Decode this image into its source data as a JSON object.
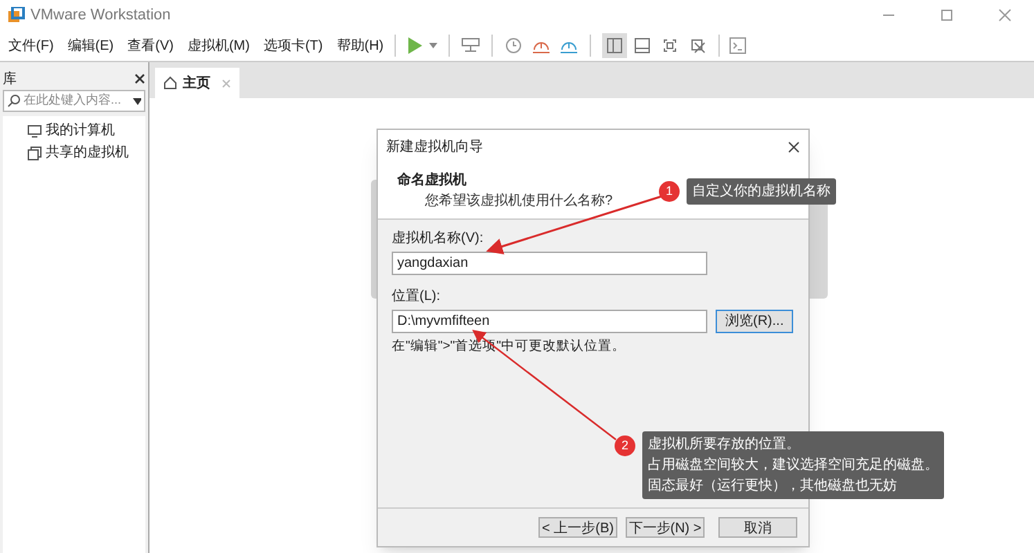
{
  "window": {
    "title": "VMware Workstation"
  },
  "menu": [
    "文件(F)",
    "编辑(E)",
    "查看(V)",
    "虚拟机(M)",
    "选项卡(T)",
    "帮助(H)"
  ],
  "view_buttons": [
    {
      "selected": true
    },
    {
      "selected": false
    },
    {
      "selected": false
    },
    {
      "selected": false
    }
  ],
  "library": {
    "title": "库",
    "search": {
      "placeholder": "在此处键入内容..."
    },
    "items": [
      {
        "label": "我的计算机"
      },
      {
        "label": "共享的虚拟机"
      }
    ]
  },
  "tabs": [
    {
      "label": "主页",
      "selected": true
    }
  ],
  "dialog": {
    "title": "新建虚拟机向导",
    "heading": "命名虚拟机",
    "subtitle": "您希望该虚拟机使用什么名称?",
    "fields": [
      {
        "label": "虚拟机名称(V):",
        "value": "yangdaxian"
      },
      {
        "label": "位置(L):",
        "value": "D:\\myvmfifteen",
        "button": "浏览(R)..."
      }
    ],
    "note": "在\"编辑\">\"首选项\"中可更改默认位置。",
    "buttons": [
      "< 上一步(B)",
      "下一步(N) >",
      "取消"
    ]
  },
  "callouts": [
    {
      "number": "1",
      "lines": [
        "自定义你的虚拟机名称"
      ]
    },
    {
      "number": "2",
      "lines": [
        "虚拟机所要存放的位置。",
        "占用磁盘空间较大，建议选择空间充足的磁盘。",
        "固态最好（运行更快），其他磁盘也无妨"
      ]
    }
  ]
}
